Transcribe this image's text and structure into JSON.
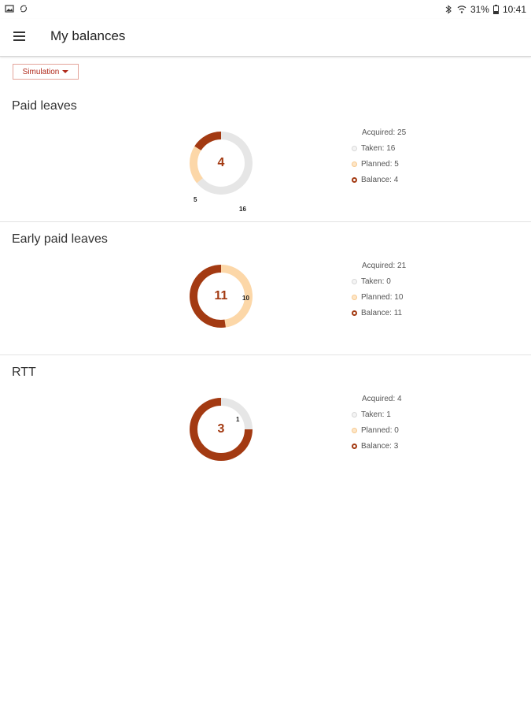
{
  "status_bar": {
    "battery": "31%",
    "time": "10:41"
  },
  "app_bar": {
    "title": "My balances"
  },
  "simulation": {
    "label": "Simulation"
  },
  "colors": {
    "taken": "#e6e6e6",
    "planned": "#fcd7a8",
    "balance": "#a33a12"
  },
  "sections": [
    {
      "title": "Paid leaves",
      "center": "4",
      "seg_labels": {
        "taken": "16",
        "planned": "5"
      },
      "legend": {
        "acquired": "Acquired: 25",
        "taken": "Taken: 16",
        "planned": "Planned: 5",
        "balance": "Balance: 4"
      }
    },
    {
      "title": "Early paid leaves",
      "center": "11",
      "seg_labels": {
        "taken": "",
        "planned": "10"
      },
      "legend": {
        "acquired": "Acquired: 21",
        "taken": "Taken: 0",
        "planned": "Planned: 10",
        "balance": "Balance: 11"
      }
    },
    {
      "title": "RTT",
      "center": "3",
      "seg_labels": {
        "taken": "1",
        "planned": ""
      },
      "legend": {
        "acquired": "Acquired: 4",
        "taken": "Taken: 1",
        "planned": "Planned: 0",
        "balance": "Balance: 3"
      }
    }
  ],
  "chart_data": [
    {
      "type": "pie",
      "title": "Paid leaves",
      "categories": [
        "Taken",
        "Planned",
        "Balance"
      ],
      "values": [
        16,
        5,
        4
      ],
      "acquired": 25
    },
    {
      "type": "pie",
      "title": "Early paid leaves",
      "categories": [
        "Taken",
        "Planned",
        "Balance"
      ],
      "values": [
        0,
        10,
        11
      ],
      "acquired": 21
    },
    {
      "type": "pie",
      "title": "RTT",
      "categories": [
        "Taken",
        "Planned",
        "Balance"
      ],
      "values": [
        1,
        0,
        3
      ],
      "acquired": 4
    }
  ]
}
